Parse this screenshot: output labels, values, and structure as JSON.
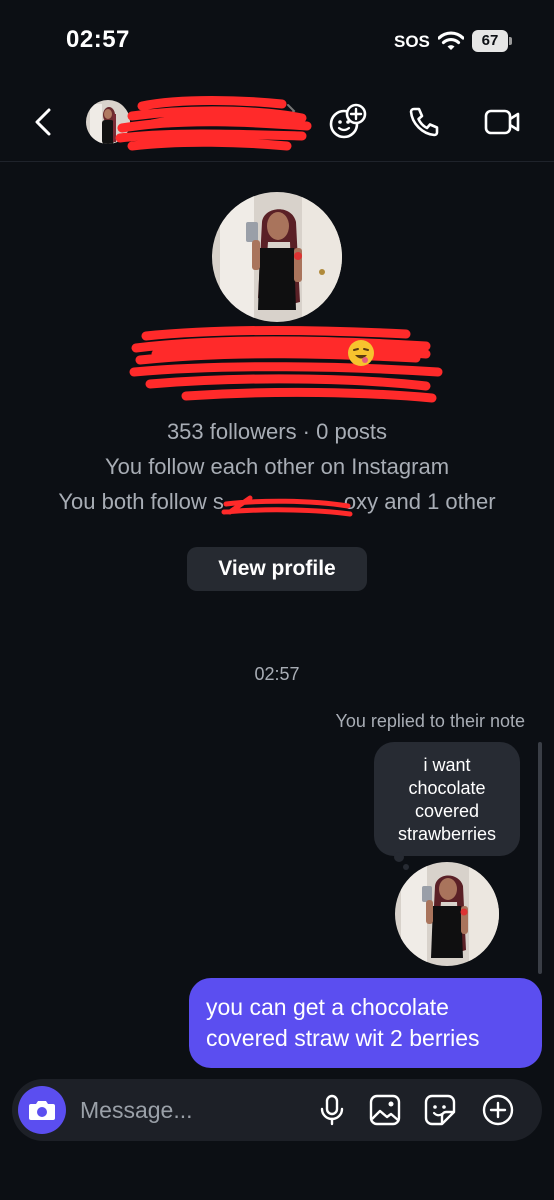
{
  "status_bar": {
    "time": "02:57",
    "sos": "SOS",
    "battery": "67"
  },
  "header": {
    "name": "",
    "username": "",
    "icons": [
      "back-arrow-icon",
      "chevron-right-icon",
      "add-people-icon",
      "phone-icon",
      "video-camera-icon"
    ]
  },
  "profile": {
    "name": "",
    "username": "",
    "stats": "353 followers · 0 posts",
    "mutual_line": "You follow each other on Instagram",
    "both_follow": "You both follow s",
    "both_follow_tail": "oxy and 1 other",
    "view_profile_label": "View profile"
  },
  "chat": {
    "timestamp": "02:57",
    "replied_label": "You replied to their note",
    "note_text": "i want\nchocolate\ncovered\nstrawberries",
    "message_text": "you can get a chocolate covered straw wit 2 berries"
  },
  "composer": {
    "placeholder": "Message...",
    "icons": [
      "camera-icon",
      "microphone-icon",
      "gallery-icon",
      "sticker-icon",
      "plus-icon"
    ]
  },
  "colors": {
    "background": "#0c0f14",
    "accent": "#5b4ef0",
    "bubble_gray": "#272b33",
    "redaction": "#ff2a2a"
  }
}
